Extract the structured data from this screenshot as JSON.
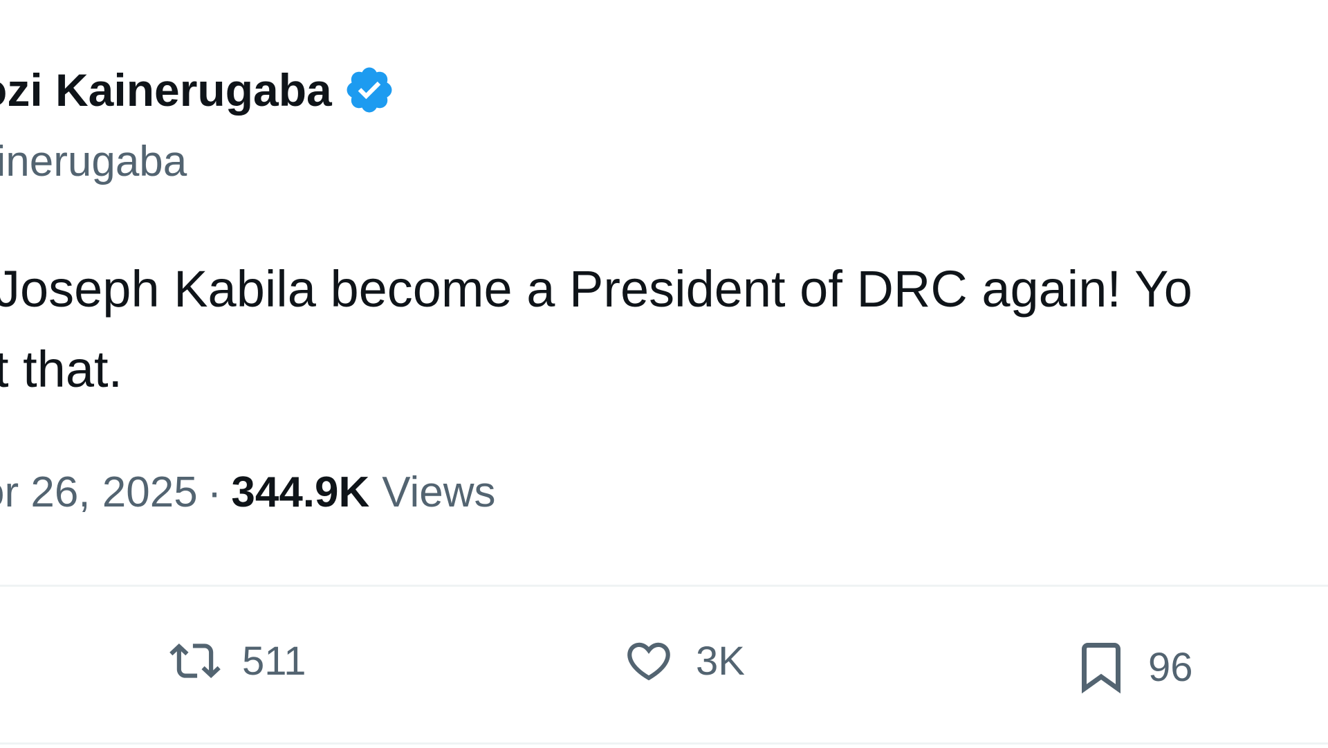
{
  "tweet": {
    "display_name": "ozi Kainerugaba",
    "handle": "ainerugaba",
    "text_line1": "Joseph Kabila become a President of DRC again! Yo",
    "text_line2": "t that.",
    "date": "or 26, 2025",
    "separator": "·",
    "views_count": "344.9K",
    "views_label": "Views"
  },
  "actions": {
    "retweets": "511",
    "likes": "3K",
    "bookmarks": "96"
  },
  "icons": {
    "verified": "verified-badge-icon",
    "retweet": "retweet-icon",
    "like": "heart-icon",
    "bookmark": "bookmark-icon"
  },
  "colors": {
    "verified_blue": "#1d9bf0",
    "text_primary": "#0f1419",
    "text_secondary": "#536471",
    "divider": "#eff3f4"
  }
}
